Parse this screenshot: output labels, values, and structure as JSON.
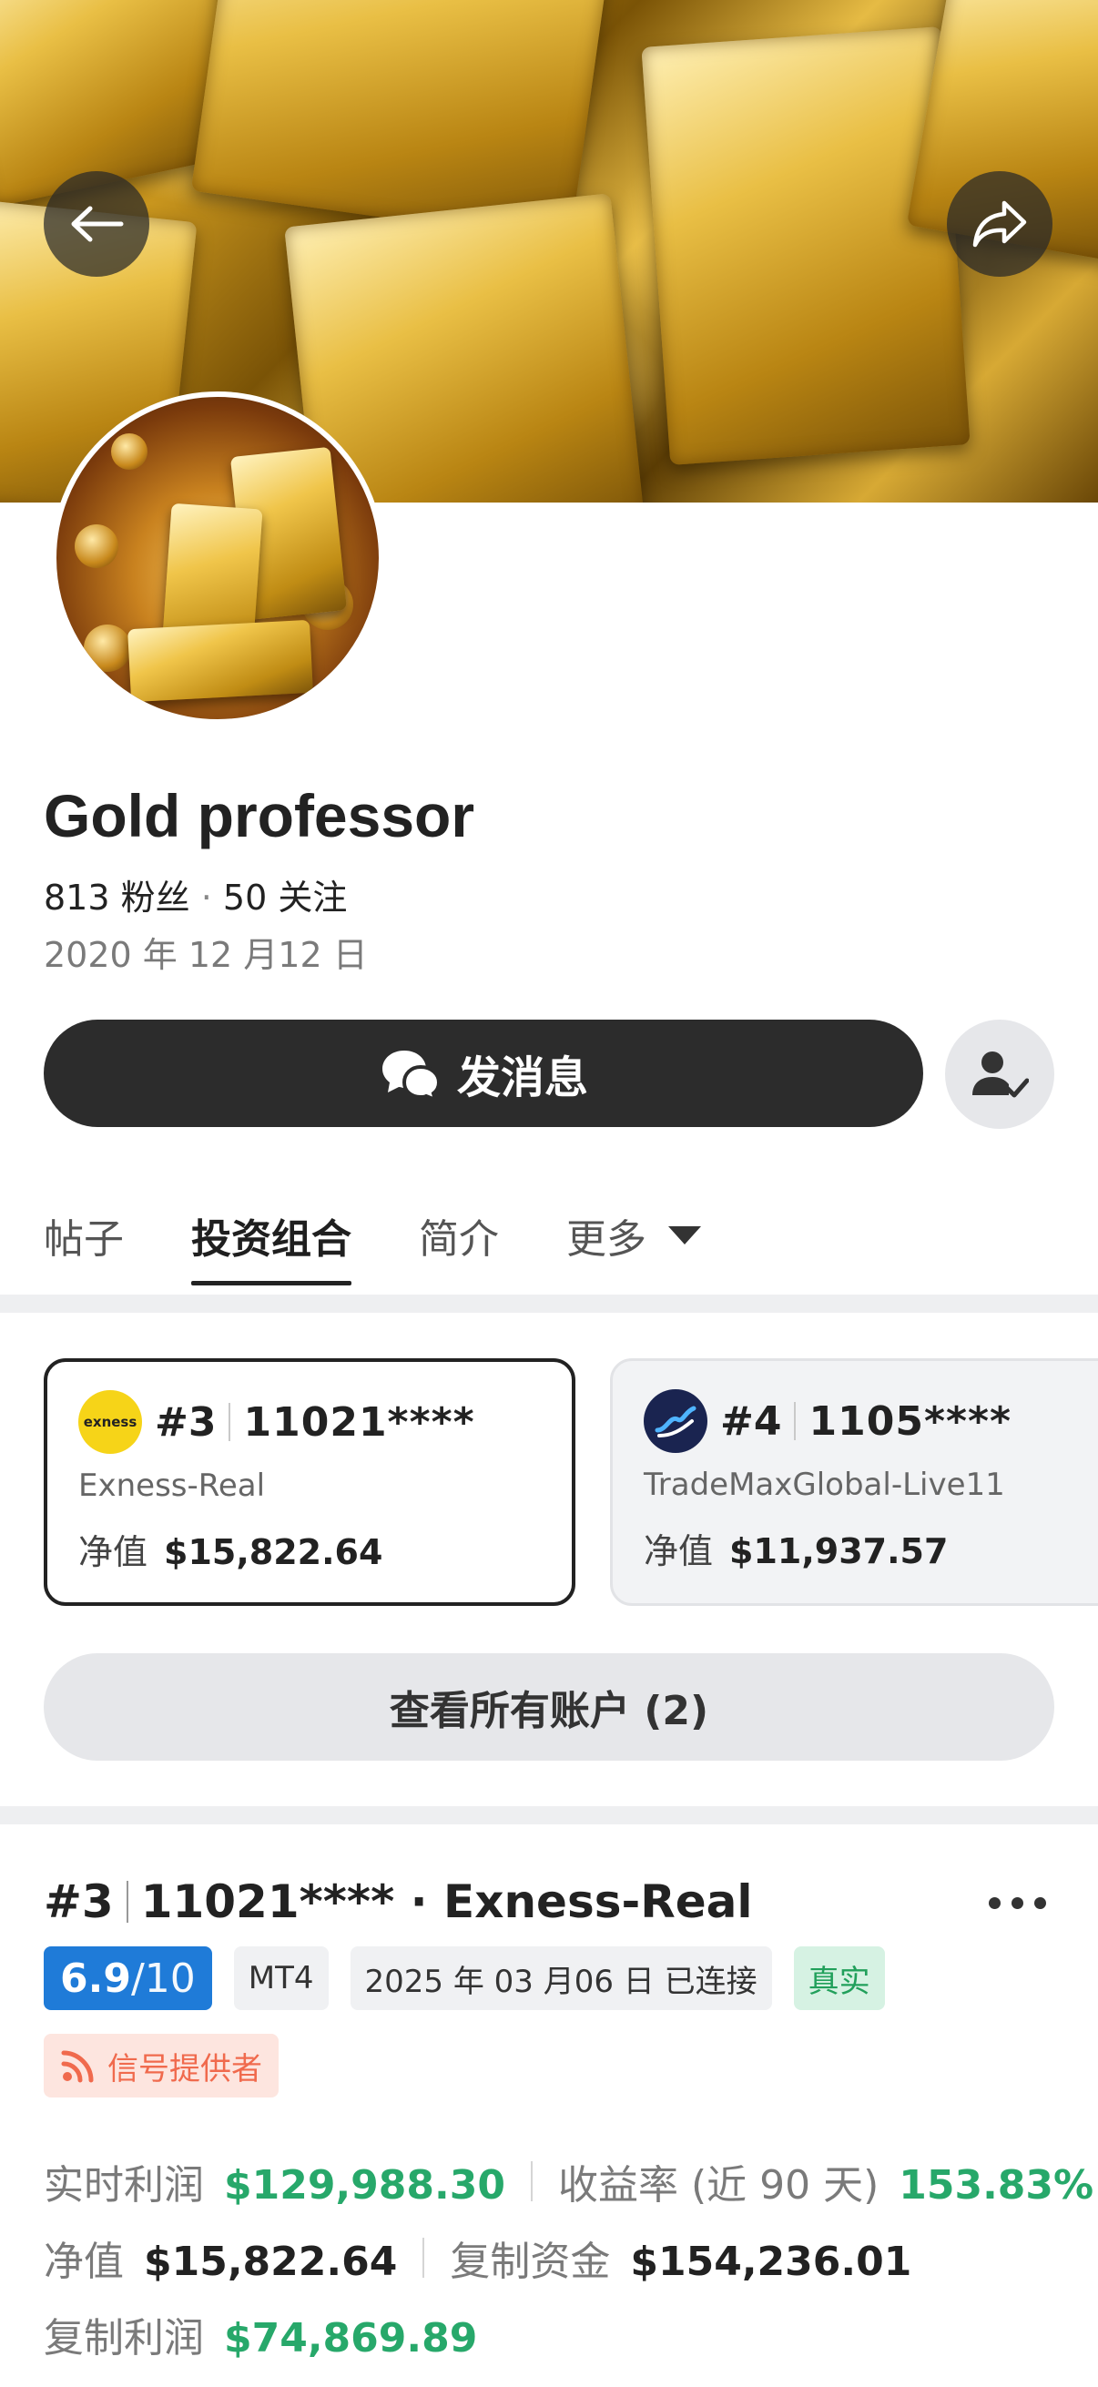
{
  "profile": {
    "name": "Gold professor",
    "followers_count": "813",
    "followers_label": "粉丝",
    "following_count": "50",
    "following_label": "关注",
    "joined_date": "2020 年 12 月12 日"
  },
  "actions": {
    "message_label": "发消息"
  },
  "tabs": [
    {
      "label": "帖子",
      "active": false
    },
    {
      "label": "投资组合",
      "active": true
    },
    {
      "label": "简介",
      "active": false
    },
    {
      "label": "更多",
      "active": false
    }
  ],
  "accounts": [
    {
      "rank": "#3",
      "number": "11021****",
      "server": "Exness-Real",
      "equity_label": "净值",
      "equity": "$15,822.64",
      "logo_text": "exness",
      "selected": true
    },
    {
      "rank": "#4",
      "number": "1105****",
      "server": "TradeMaxGlobal-Live11",
      "equity_label": "净值",
      "equity": "$11,937.57",
      "selected": false
    }
  ],
  "view_all_label": "查看所有账户 (2)",
  "detail": {
    "rank": "#3",
    "title": "11021**** · Exness-Real",
    "score": "6.9",
    "score_max": "/10",
    "platform": "MT4",
    "connected": "2025 年 03 月06 日 已连接",
    "real_label": "真实",
    "signal_label": "信号提供者",
    "metrics": {
      "realtime_profit_label": "实时利润",
      "realtime_profit": "$129,988.30",
      "return_label": "收益率 (近 90 天)",
      "return_value": "153.83%",
      "equity_label": "净值",
      "equity": "$15,822.64",
      "copy_funds_label": "复制资金",
      "copy_funds": "$154,236.01",
      "copy_profit_label": "复制利润",
      "copy_profit": "$74,869.89"
    }
  },
  "colors": {
    "accent_blue": "#1f7bd8",
    "profit_green": "#27a86a",
    "signal_orange": "#f06a4d",
    "dark_button": "#2c2c2c"
  }
}
